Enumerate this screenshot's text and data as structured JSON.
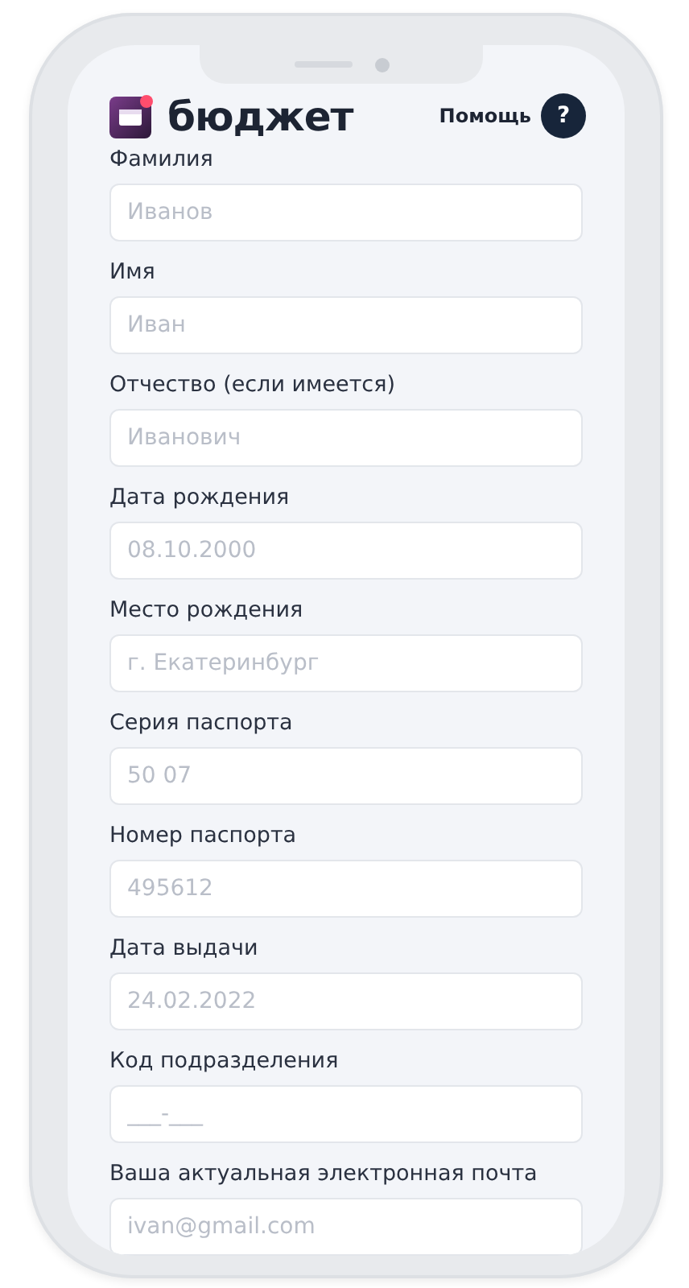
{
  "header": {
    "brand": "бюджет",
    "help_label": "Помощь",
    "help_button": "?"
  },
  "fields": [
    {
      "label": "Фамилия",
      "placeholder": "Иванов"
    },
    {
      "label": "Имя",
      "placeholder": "Иван"
    },
    {
      "label": "Отчество (если имеется)",
      "placeholder": "Иванович"
    },
    {
      "label": "Дата рождения",
      "placeholder": "08.10.2000"
    },
    {
      "label": "Место рождения",
      "placeholder": "г. Екатеринбург"
    },
    {
      "label": "Серия паспорта",
      "placeholder": "50 07"
    },
    {
      "label": "Номер паспорта",
      "placeholder": "495612"
    },
    {
      "label": "Дата выдачи",
      "placeholder": "24.02.2022"
    },
    {
      "label": "Код подразделения",
      "placeholder": "___-___"
    },
    {
      "label": "Ваша актуальная электронная почта",
      "placeholder": "ivan@gmail.com"
    }
  ]
}
